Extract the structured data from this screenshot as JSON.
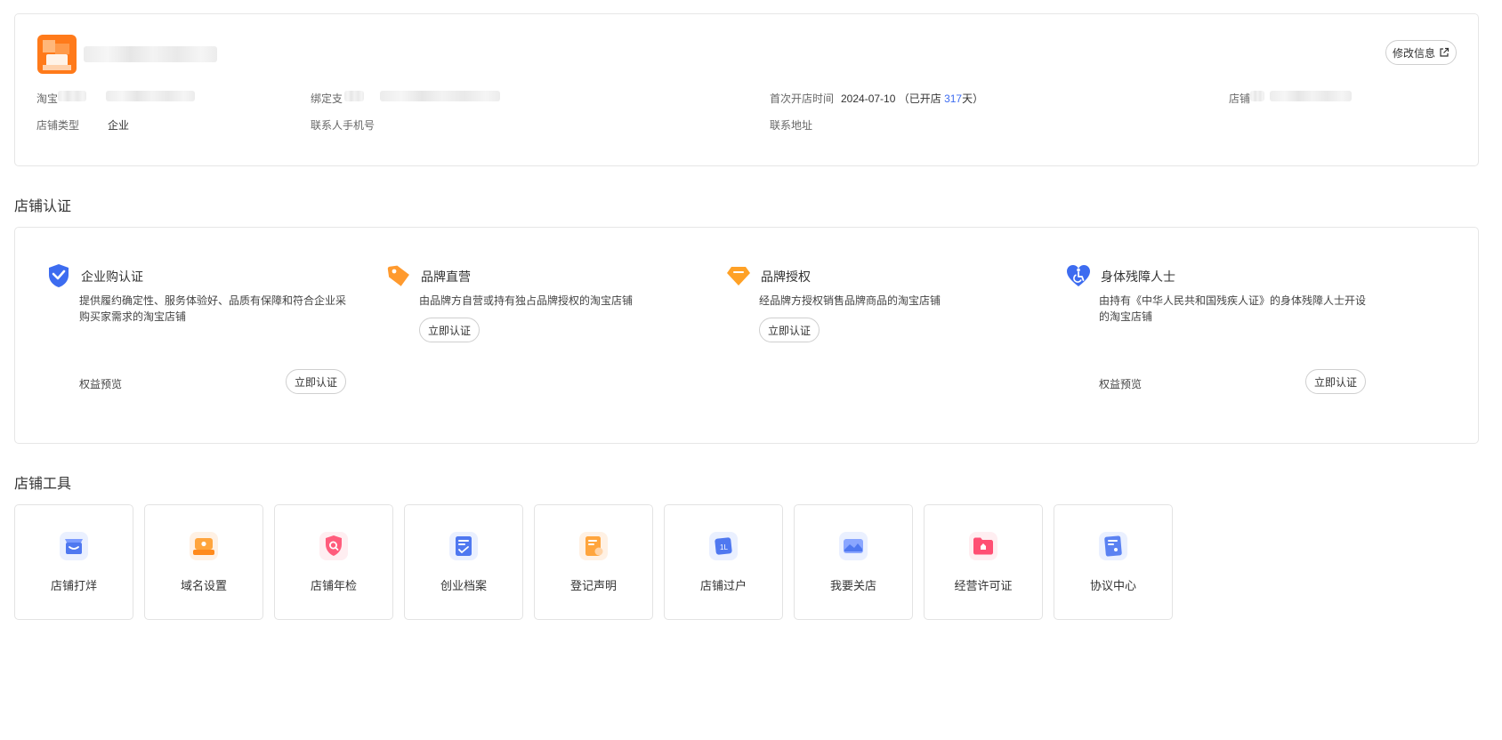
{
  "profile": {
    "edit_button": "修改信息",
    "fields": [
      {
        "label": "淘宝",
        "value": ""
      },
      {
        "label": "绑定支",
        "value": ""
      },
      {
        "label": "首次开店时间",
        "value_prefix": "2024-07-10 （已开店 ",
        "days": "317",
        "value_suffix": "天）"
      },
      {
        "label": "店铺",
        "value": ""
      },
      {
        "label": "店铺类型",
        "value": "企业"
      },
      {
        "label": "联系人手机号",
        "value": ""
      },
      {
        "label": "联系地址",
        "value": ""
      }
    ]
  },
  "cert_section": {
    "title": "店铺认证",
    "items": [
      {
        "icon": "shield-check-icon",
        "title": "企业购认证",
        "desc": "提供履约确定性、服务体验好、品质有保障和符合企业采购买家需求的淘宝店铺",
        "perks": "权益预览",
        "button": "立即认证"
      },
      {
        "icon": "tag-icon",
        "title": "品牌直营",
        "desc": "由品牌方自营或持有独占品牌授权的淘宝店铺",
        "button": "立即认证"
      },
      {
        "icon": "diamond-icon",
        "title": "品牌授权",
        "desc": "经品牌方授权销售品牌商品的淘宝店铺",
        "button": "立即认证"
      },
      {
        "icon": "heart-accessibility-icon",
        "title": "身体残障人士",
        "desc": "由持有《中华人民共和国残疾人证》的身体残障人士开设的淘宝店铺",
        "perks": "权益预览",
        "button": "立即认证"
      }
    ]
  },
  "tools_section": {
    "title": "店铺工具",
    "items": [
      {
        "label": "店铺打烊",
        "icon": "shop-closed-icon"
      },
      {
        "label": "域名设置",
        "icon": "domain-icon"
      },
      {
        "label": "店铺年检",
        "icon": "inspection-shield-icon"
      },
      {
        "label": "创业档案",
        "icon": "archive-icon"
      },
      {
        "label": "登记声明",
        "icon": "declaration-icon"
      },
      {
        "label": "店铺过户",
        "icon": "transfer-icon"
      },
      {
        "label": "我要关店",
        "icon": "close-shop-icon"
      },
      {
        "label": "经营许可证",
        "icon": "license-folder-icon"
      },
      {
        "label": "协议中心",
        "icon": "agreement-icon"
      }
    ]
  },
  "colors": {
    "accent_blue": "#3d6cf0",
    "brand_orange": "#ff7a1a",
    "border": "#e6e6e6"
  }
}
